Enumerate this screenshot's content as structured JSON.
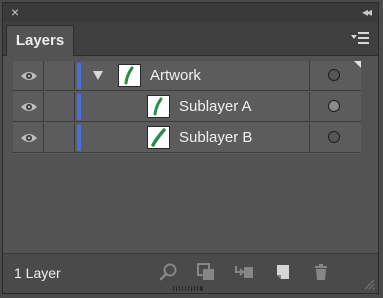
{
  "panel": {
    "close_glyph": "×",
    "collapse_glyph": "◂◂",
    "tab_label": "Layers",
    "menu_icon": "panel-menu-icon"
  },
  "layers": [
    {
      "name": "Artwork",
      "visible": true,
      "expanded": true,
      "target_selected": false,
      "color": "#4b6fd8"
    },
    {
      "name": "Sublayer A",
      "visible": true,
      "target_selected": true,
      "color": "#4b6fd8"
    },
    {
      "name": "Sublayer B",
      "visible": true,
      "target_selected": false,
      "color": "#4b6fd8"
    }
  ],
  "footer": {
    "status": "1 Layer",
    "icons": [
      "locate-object-icon",
      "make-clipping-mask-icon",
      "create-sublayer-icon",
      "create-new-layer-icon",
      "delete-layer-icon"
    ]
  }
}
